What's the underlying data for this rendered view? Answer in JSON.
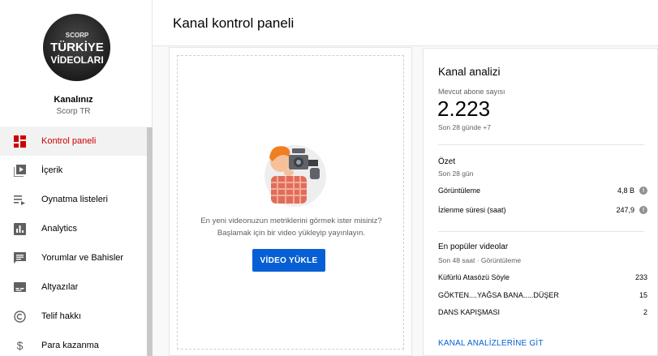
{
  "channel": {
    "avatar_text": [
      "SCORP",
      "TÜRKİYE",
      "VİDEOLARI"
    ],
    "title": "Kanalınız",
    "subtitle": "Scorp TR"
  },
  "sidebar": {
    "items": [
      {
        "label": "Kontrol paneli",
        "icon": "dashboard-icon",
        "active": true
      },
      {
        "label": "İçerik",
        "icon": "video-library-icon"
      },
      {
        "label": "Oynatma listeleri",
        "icon": "playlist-icon"
      },
      {
        "label": "Analytics",
        "icon": "bar-chart-icon"
      },
      {
        "label": "Yorumlar ve Bahisler",
        "icon": "comment-icon"
      },
      {
        "label": "Altyazılar",
        "icon": "subtitles-icon"
      },
      {
        "label": "Telif hakkı",
        "icon": "copyright-icon"
      },
      {
        "label": "Para kazanma",
        "icon": "dollar-icon"
      }
    ]
  },
  "header": {
    "title": "Kanal kontrol paneli"
  },
  "upload": {
    "prompt_line1": "En yeni videonuzun metriklerini görmek ister misiniz?",
    "prompt_line2": "Başlamak için bir video yükleyip yayınlayın.",
    "button_label": "VİDEO YÜKLE"
  },
  "analytics": {
    "title": "Kanal analizi",
    "subscribers_label": "Mevcut abone sayısı",
    "subscribers_value": "2.223",
    "delta_prefix": "Son 28 günde",
    "delta_value": "+7",
    "summary": {
      "title": "Özet",
      "period": "Son 28 gün",
      "rows": [
        {
          "label": "Görüntüleme",
          "value": "4,8 B"
        },
        {
          "label": "İzlenme süresi (saat)",
          "value": "247,9"
        }
      ]
    },
    "popular": {
      "title": "En popüler videolar",
      "period": "Son 48 saat · Görüntüleme",
      "rows": [
        {
          "label": "Küfürlü Atasözü Söyle",
          "value": "233"
        },
        {
          "label": "GÖKTEN....YAĞSA BANA.....DÜŞER",
          "value": "15"
        },
        {
          "label": "DANS KAPIŞMASI",
          "value": "2"
        }
      ]
    },
    "link_label": "KANAL ANALİZLERİNE GİT"
  },
  "colors": {
    "accent": "#cc0000",
    "button": "#065fd4",
    "link": "#065fd4"
  }
}
